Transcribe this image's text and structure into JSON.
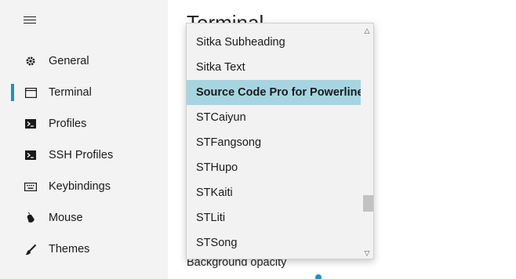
{
  "sidebar": {
    "items": [
      {
        "label": "General",
        "icon": "gear-icon"
      },
      {
        "label": "Terminal",
        "icon": "window-icon"
      },
      {
        "label": "Profiles",
        "icon": "terminal-prompt-icon"
      },
      {
        "label": "SSH Profiles",
        "icon": "terminal-prompt-icon"
      },
      {
        "label": "Keybindings",
        "icon": "keyboard-icon"
      },
      {
        "label": "Mouse",
        "icon": "mouse-icon"
      },
      {
        "label": "Themes",
        "icon": "brush-icon"
      }
    ],
    "active_index": 1
  },
  "main": {
    "title": "Terminal",
    "background_opacity_label": "Background opacity"
  },
  "font_dropdown": {
    "options": [
      "Sitka Subheading",
      "Sitka Text",
      "Source Code Pro for Powerline",
      "STCaiyun",
      "STFangsong",
      "STHupo",
      "STKaiti",
      "STLiti",
      "STSong"
    ],
    "selected": "Source Code Pro for Powerline"
  },
  "colors": {
    "accent": "#1a93c6",
    "selection": "#a6d5e1",
    "sidebar_bg": "#f3f3f3"
  }
}
